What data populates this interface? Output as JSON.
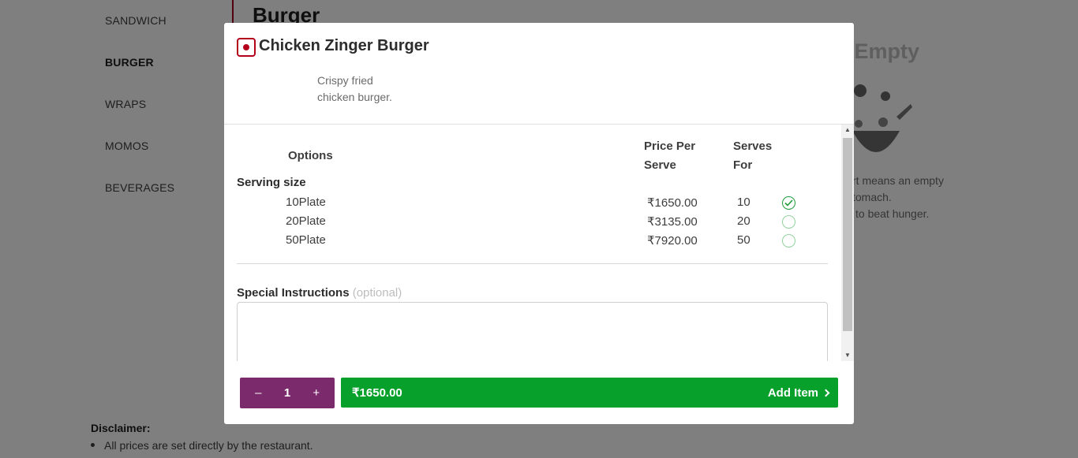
{
  "background": {
    "menu": [
      {
        "label": "SANDWICH",
        "active": false
      },
      {
        "label": "BURGER",
        "active": true
      },
      {
        "label": "WRAPS",
        "active": false
      },
      {
        "label": "MOMOS",
        "active": false
      },
      {
        "label": "BEVERAGES",
        "active": false
      }
    ],
    "section_title": "Burger",
    "cart": {
      "title": "t Empty",
      "lines": [
        "rt means an empty",
        "tomach.",
        "to beat hunger."
      ]
    },
    "disclaimer": {
      "title": "Disclaimer:",
      "items": [
        "All prices are set directly by the restaurant."
      ]
    }
  },
  "modal": {
    "title": "Chicken Zinger Burger",
    "description": "Crispy fried chicken burger.",
    "columns": {
      "options": "Options",
      "price_line1": "Price Per",
      "price_line2": "Serve",
      "serves_line1": "Serves",
      "serves_line2": "For"
    },
    "group_label": "Serving size",
    "options": [
      {
        "name": "10Plate",
        "price": "₹1650.00",
        "serves": "10",
        "selected": true
      },
      {
        "name": "20Plate",
        "price": "₹3135.00",
        "serves": "20",
        "selected": false
      },
      {
        "name": "50Plate",
        "price": "₹7920.00",
        "serves": "50",
        "selected": false
      }
    ],
    "special_instructions": {
      "label": "Special Instructions",
      "optional": "(optional)",
      "value": ""
    },
    "quantity": {
      "minus": "–",
      "value": "1",
      "plus": "+"
    },
    "add_button": {
      "price": "₹1650.00",
      "label": "Add Item"
    }
  },
  "colors": {
    "brand": "#b3001b",
    "quantity_bg": "#7b2a6b",
    "add_button_bg": "#06a02a",
    "radio_checked": "#1e9b3a"
  }
}
